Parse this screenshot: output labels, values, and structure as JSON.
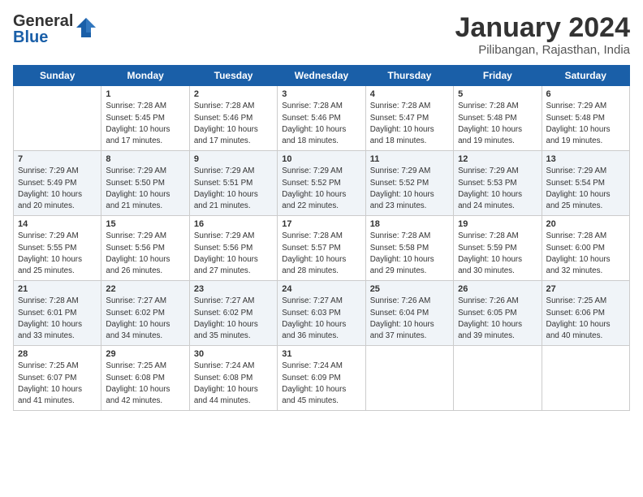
{
  "header": {
    "logo_general": "General",
    "logo_blue": "Blue",
    "month_title": "January 2024",
    "location": "Pilibangan, Rajasthan, India"
  },
  "days_of_week": [
    "Sunday",
    "Monday",
    "Tuesday",
    "Wednesday",
    "Thursday",
    "Friday",
    "Saturday"
  ],
  "weeks": [
    [
      {
        "day": "",
        "info": ""
      },
      {
        "day": "1",
        "info": "Sunrise: 7:28 AM\nSunset: 5:45 PM\nDaylight: 10 hours\nand 17 minutes."
      },
      {
        "day": "2",
        "info": "Sunrise: 7:28 AM\nSunset: 5:46 PM\nDaylight: 10 hours\nand 17 minutes."
      },
      {
        "day": "3",
        "info": "Sunrise: 7:28 AM\nSunset: 5:46 PM\nDaylight: 10 hours\nand 18 minutes."
      },
      {
        "day": "4",
        "info": "Sunrise: 7:28 AM\nSunset: 5:47 PM\nDaylight: 10 hours\nand 18 minutes."
      },
      {
        "day": "5",
        "info": "Sunrise: 7:28 AM\nSunset: 5:48 PM\nDaylight: 10 hours\nand 19 minutes."
      },
      {
        "day": "6",
        "info": "Sunrise: 7:29 AM\nSunset: 5:48 PM\nDaylight: 10 hours\nand 19 minutes."
      }
    ],
    [
      {
        "day": "7",
        "info": "Sunrise: 7:29 AM\nSunset: 5:49 PM\nDaylight: 10 hours\nand 20 minutes."
      },
      {
        "day": "8",
        "info": "Sunrise: 7:29 AM\nSunset: 5:50 PM\nDaylight: 10 hours\nand 21 minutes."
      },
      {
        "day": "9",
        "info": "Sunrise: 7:29 AM\nSunset: 5:51 PM\nDaylight: 10 hours\nand 21 minutes."
      },
      {
        "day": "10",
        "info": "Sunrise: 7:29 AM\nSunset: 5:52 PM\nDaylight: 10 hours\nand 22 minutes."
      },
      {
        "day": "11",
        "info": "Sunrise: 7:29 AM\nSunset: 5:52 PM\nDaylight: 10 hours\nand 23 minutes."
      },
      {
        "day": "12",
        "info": "Sunrise: 7:29 AM\nSunset: 5:53 PM\nDaylight: 10 hours\nand 24 minutes."
      },
      {
        "day": "13",
        "info": "Sunrise: 7:29 AM\nSunset: 5:54 PM\nDaylight: 10 hours\nand 25 minutes."
      }
    ],
    [
      {
        "day": "14",
        "info": "Sunrise: 7:29 AM\nSunset: 5:55 PM\nDaylight: 10 hours\nand 25 minutes."
      },
      {
        "day": "15",
        "info": "Sunrise: 7:29 AM\nSunset: 5:56 PM\nDaylight: 10 hours\nand 26 minutes."
      },
      {
        "day": "16",
        "info": "Sunrise: 7:29 AM\nSunset: 5:56 PM\nDaylight: 10 hours\nand 27 minutes."
      },
      {
        "day": "17",
        "info": "Sunrise: 7:28 AM\nSunset: 5:57 PM\nDaylight: 10 hours\nand 28 minutes."
      },
      {
        "day": "18",
        "info": "Sunrise: 7:28 AM\nSunset: 5:58 PM\nDaylight: 10 hours\nand 29 minutes."
      },
      {
        "day": "19",
        "info": "Sunrise: 7:28 AM\nSunset: 5:59 PM\nDaylight: 10 hours\nand 30 minutes."
      },
      {
        "day": "20",
        "info": "Sunrise: 7:28 AM\nSunset: 6:00 PM\nDaylight: 10 hours\nand 32 minutes."
      }
    ],
    [
      {
        "day": "21",
        "info": "Sunrise: 7:28 AM\nSunset: 6:01 PM\nDaylight: 10 hours\nand 33 minutes."
      },
      {
        "day": "22",
        "info": "Sunrise: 7:27 AM\nSunset: 6:02 PM\nDaylight: 10 hours\nand 34 minutes."
      },
      {
        "day": "23",
        "info": "Sunrise: 7:27 AM\nSunset: 6:02 PM\nDaylight: 10 hours\nand 35 minutes."
      },
      {
        "day": "24",
        "info": "Sunrise: 7:27 AM\nSunset: 6:03 PM\nDaylight: 10 hours\nand 36 minutes."
      },
      {
        "day": "25",
        "info": "Sunrise: 7:26 AM\nSunset: 6:04 PM\nDaylight: 10 hours\nand 37 minutes."
      },
      {
        "day": "26",
        "info": "Sunrise: 7:26 AM\nSunset: 6:05 PM\nDaylight: 10 hours\nand 39 minutes."
      },
      {
        "day": "27",
        "info": "Sunrise: 7:25 AM\nSunset: 6:06 PM\nDaylight: 10 hours\nand 40 minutes."
      }
    ],
    [
      {
        "day": "28",
        "info": "Sunrise: 7:25 AM\nSunset: 6:07 PM\nDaylight: 10 hours\nand 41 minutes."
      },
      {
        "day": "29",
        "info": "Sunrise: 7:25 AM\nSunset: 6:08 PM\nDaylight: 10 hours\nand 42 minutes."
      },
      {
        "day": "30",
        "info": "Sunrise: 7:24 AM\nSunset: 6:08 PM\nDaylight: 10 hours\nand 44 minutes."
      },
      {
        "day": "31",
        "info": "Sunrise: 7:24 AM\nSunset: 6:09 PM\nDaylight: 10 hours\nand 45 minutes."
      },
      {
        "day": "",
        "info": ""
      },
      {
        "day": "",
        "info": ""
      },
      {
        "day": "",
        "info": ""
      }
    ]
  ]
}
